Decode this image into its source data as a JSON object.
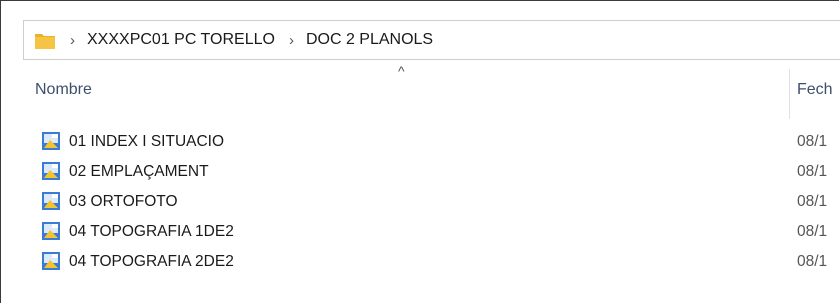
{
  "breadcrumb": {
    "separator": "›",
    "items": [
      "XXXXPC01 PC TORELLO",
      "DOC 2 PLANOLS"
    ]
  },
  "columns": {
    "sort_indicator": "^",
    "name_header": "Nombre",
    "date_header": "Fech"
  },
  "files": [
    {
      "name": "01 INDEX I SITUACIO",
      "date": "08/1"
    },
    {
      "name": "02 EMPLAÇAMENT",
      "date": "08/1"
    },
    {
      "name": "03 ORTOFOTO",
      "date": "08/1"
    },
    {
      "name": "04 TOPOGRAFIA 1DE2",
      "date": "08/1"
    },
    {
      "name": "04 TOPOGRAFIA 2DE2",
      "date": "08/1"
    }
  ],
  "colors": {
    "folder": "#f6c445",
    "file_icon_blue": "#3a7bd5",
    "file_icon_yellow": "#f4c430"
  },
  "icons": {
    "folder": "folder-icon",
    "file": "image-file-icon"
  }
}
